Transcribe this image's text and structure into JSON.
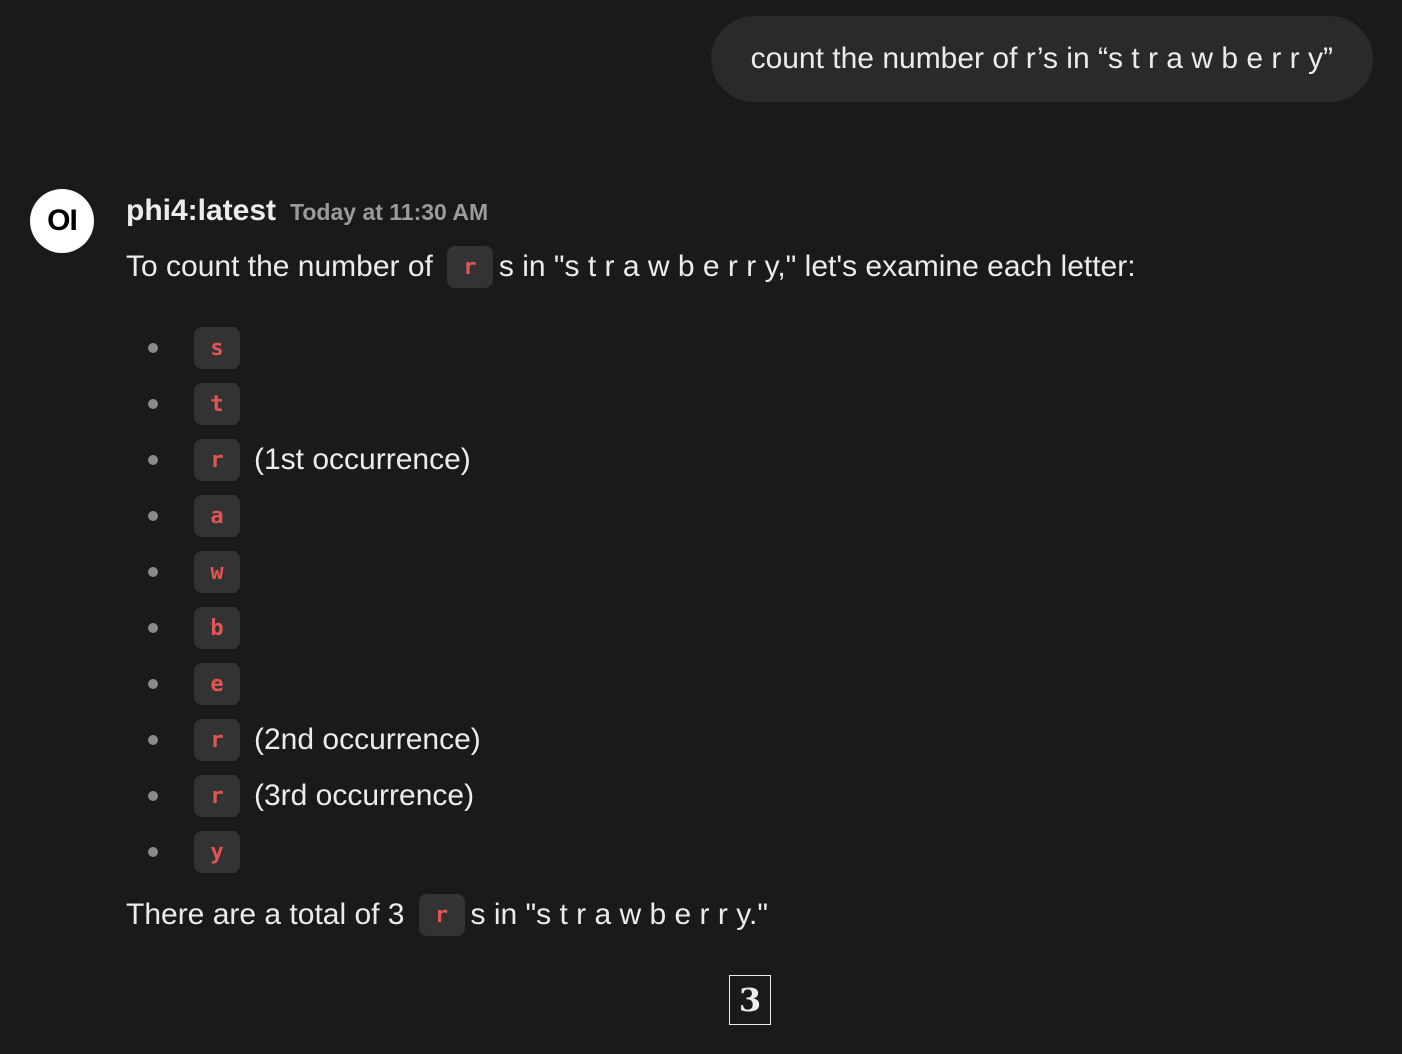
{
  "user_message": {
    "text": "count the number of r’s in “s t r a w b e r r y”"
  },
  "assistant": {
    "avatar_text": "OI",
    "model_name": "phi4:latest",
    "timestamp": "Today at 11:30 AM",
    "intro": {
      "before": "To count the number of",
      "code": "r",
      "after": "s in \"s t r a w b e r r y,\" let's examine each letter:"
    },
    "letters": [
      {
        "code": "s",
        "note": ""
      },
      {
        "code": "t",
        "note": ""
      },
      {
        "code": "r",
        "note": "(1st occurrence)"
      },
      {
        "code": "a",
        "note": ""
      },
      {
        "code": "w",
        "note": ""
      },
      {
        "code": "b",
        "note": ""
      },
      {
        "code": "e",
        "note": ""
      },
      {
        "code": "r",
        "note": "(2nd occurrence)"
      },
      {
        "code": "r",
        "note": "(3rd occurrence)"
      },
      {
        "code": "y",
        "note": ""
      }
    ],
    "summary": {
      "before": "There are a total of 3",
      "code": "r",
      "after": "s in \"s t r a w b e r r y.\""
    },
    "boxed_answer": "3"
  },
  "colors": {
    "background": "#1a1a1a",
    "bubble": "#2a2a2a",
    "code_bg": "#333333",
    "code_text": "#e45454",
    "timestamp": "#9b9b9b"
  }
}
